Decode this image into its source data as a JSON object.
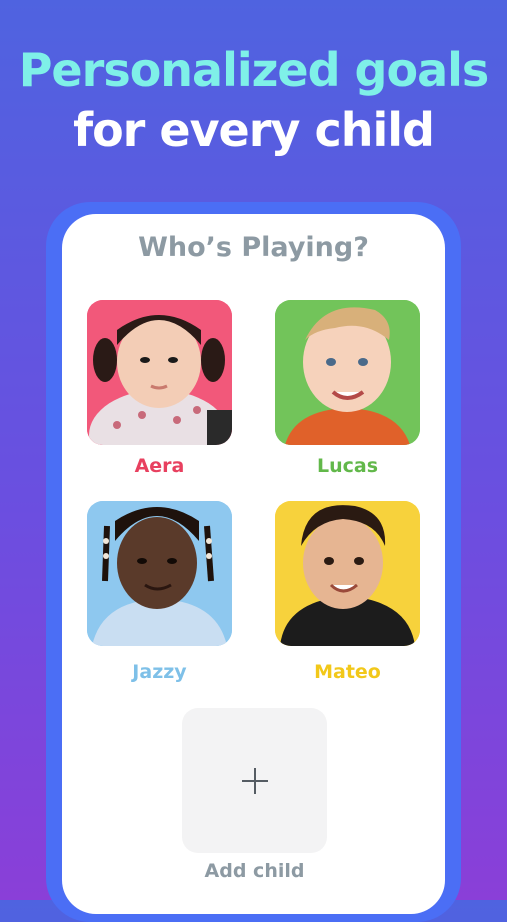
{
  "headline": {
    "line1": "Personalized goals",
    "line2": "for every child"
  },
  "screen": {
    "title": "Who’s Playing?"
  },
  "children": [
    {
      "name": "Aera",
      "name_color": "#e8405f",
      "bg_color": "#f2587a"
    },
    {
      "name": "Lucas",
      "name_color": "#62b84a",
      "bg_color": "#72c45a"
    },
    {
      "name": "Jazzy",
      "name_color": "#7ec0e8",
      "bg_color": "#8ec8ef"
    },
    {
      "name": "Mateo",
      "name_color": "#f2c81a",
      "bg_color": "#f7d23c"
    }
  ],
  "add_child": {
    "label": "Add child",
    "icon": "plus-icon"
  }
}
